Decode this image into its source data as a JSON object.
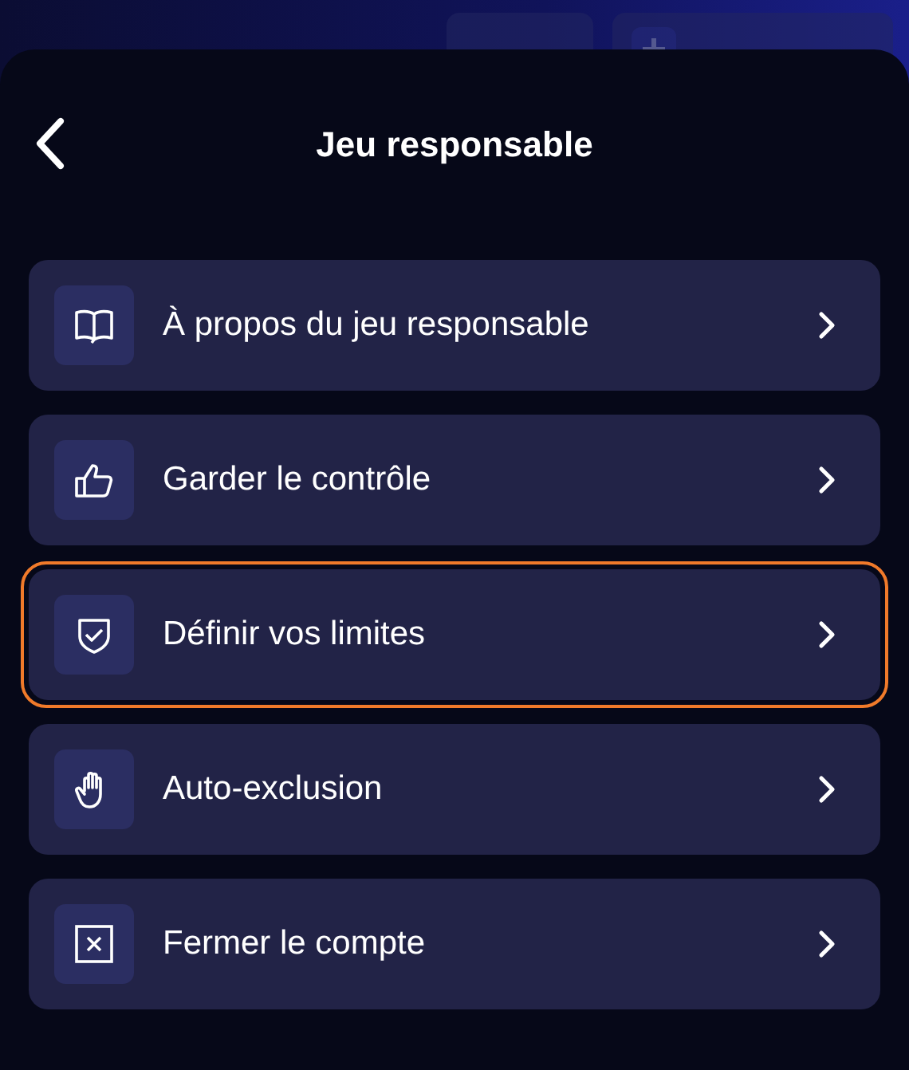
{
  "sheet": {
    "title": "Jeu responsable",
    "items": [
      {
        "label": "À propos du jeu responsable",
        "kind": "book",
        "focused": false
      },
      {
        "label": "Garder le contrôle",
        "kind": "thumb",
        "focused": false
      },
      {
        "label": "Définir vos limites",
        "kind": "shield",
        "focused": true
      },
      {
        "label": "Auto-exclusion",
        "kind": "hand",
        "focused": false
      },
      {
        "label": "Fermer le compte",
        "kind": "close",
        "focused": false
      }
    ]
  }
}
